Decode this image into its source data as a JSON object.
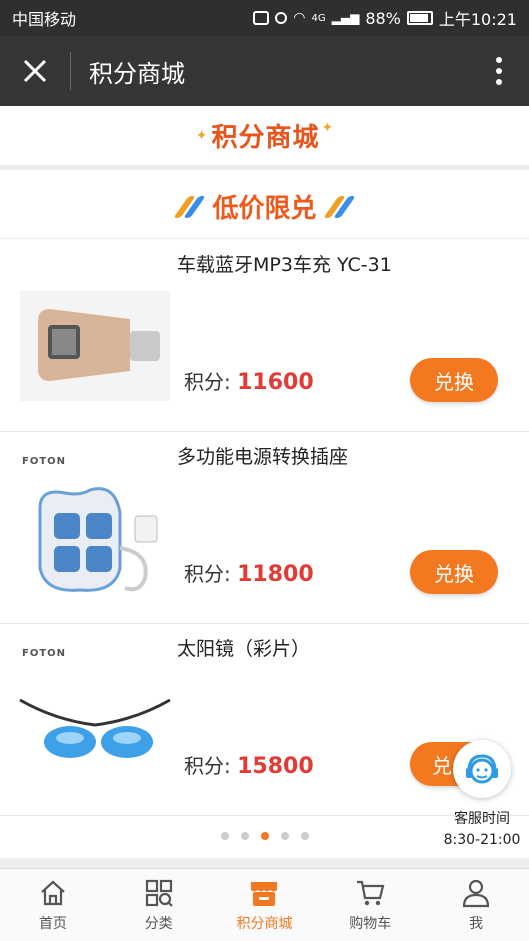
{
  "status": {
    "carrier": "中国移动",
    "battery": "88%",
    "time": "上午10:21",
    "network": "4G"
  },
  "header": {
    "title": "积分商城"
  },
  "banner": {
    "text": "积分商城"
  },
  "section": {
    "title": "低价限兑"
  },
  "products": [
    {
      "name": "车载蓝牙MP3车充 YC-31",
      "price_label": "积分:",
      "price": "11600",
      "button": "兑换",
      "brand": ""
    },
    {
      "name": "多功能电源转换插座",
      "price_label": "积分:",
      "price": "11800",
      "button": "兑换",
      "brand": "FOTON"
    },
    {
      "name": "太阳镜（彩片）",
      "price_label": "积分:",
      "price": "15800",
      "button": "兑",
      "brand": "FOTON"
    }
  ],
  "service": {
    "title": "客服时间",
    "hours": "8:30-21:00"
  },
  "carousel": {
    "count": 5,
    "active": 3
  },
  "tabs": [
    {
      "label": "首页",
      "icon": "home-icon"
    },
    {
      "label": "分类",
      "icon": "category-icon"
    },
    {
      "label": "积分商城",
      "icon": "shop-icon"
    },
    {
      "label": "购物车",
      "icon": "cart-icon"
    },
    {
      "label": "我",
      "icon": "user-icon"
    }
  ],
  "colors": {
    "accent": "#f47820",
    "price": "#e43a35",
    "titlebar": "#363636"
  }
}
